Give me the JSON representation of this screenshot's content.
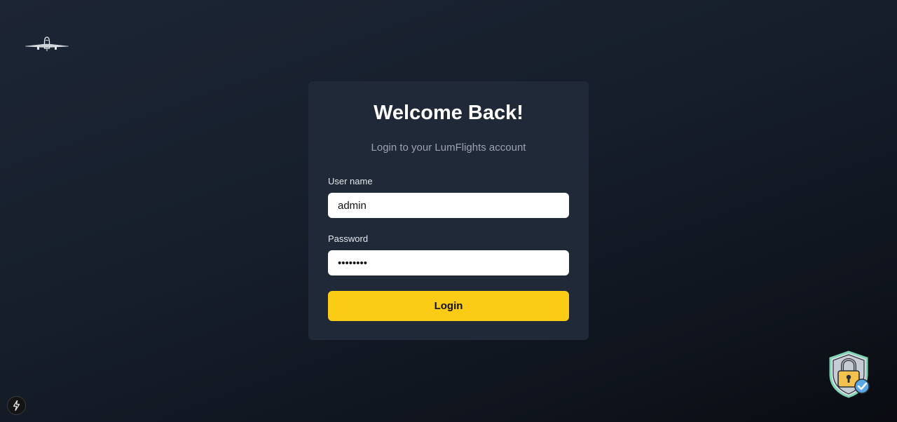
{
  "brand": {
    "logo_icon": "airplane-icon"
  },
  "login": {
    "title": "Welcome Back!",
    "subtitle": "Login to your LumFlights account",
    "username_label": "User name",
    "username_value": "admin",
    "password_label": "Password",
    "password_value": "password",
    "submit_label": "Login"
  },
  "badges": {
    "security_icon": "security-shield-lock-icon",
    "devtools_icon": "lightning-bolt-icon"
  },
  "colors": {
    "background": "#161e2b",
    "card": "#1f2937",
    "accent": "#facc15",
    "subtitle": "#9ca3af"
  }
}
